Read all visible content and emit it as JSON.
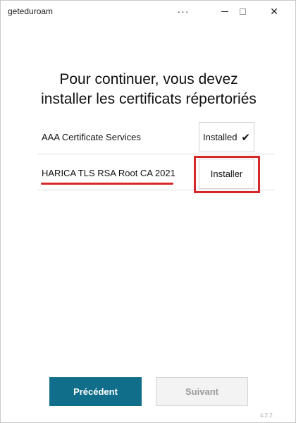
{
  "window": {
    "title": "geteduroam",
    "more_icon": "···",
    "close_glyph": "✕"
  },
  "main": {
    "heading_line1": "Pour continuer, vous devez",
    "heading_line2": "installer les certificats répertoriés"
  },
  "certificates": [
    {
      "name": "AAA Certificate Services",
      "button_label": "Installed",
      "status": "installed",
      "icon": "check-icon"
    },
    {
      "name": "HARICA TLS RSA Root CA 2021",
      "button_label": "Installer",
      "status": "not-installed"
    }
  ],
  "footer": {
    "previous_label": "Précédent",
    "next_label": "Suivant",
    "version": "4.2.2"
  },
  "colors": {
    "accent": "#106e8b",
    "highlight": "#d62828"
  }
}
